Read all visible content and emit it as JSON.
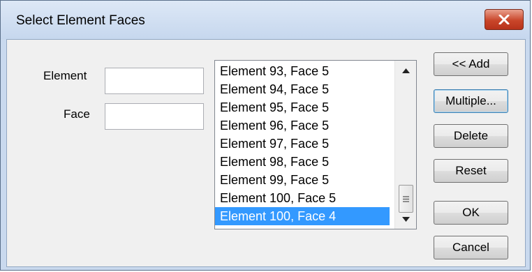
{
  "window": {
    "title": "Select Element Faces"
  },
  "icons": {
    "close": "close-icon",
    "scroll_up": "chevron-up-icon",
    "scroll_down": "chevron-down-icon",
    "thumb_grip": "grip-icon"
  },
  "colors": {
    "selection": "#3399ff",
    "close_button": "#c9462a",
    "title_bar": "#c6d7ee"
  },
  "form": {
    "element_label": "Element",
    "element_value": "",
    "face_label": "Face",
    "face_value": ""
  },
  "list": {
    "items": [
      "Element 93, Face 5",
      "Element 94, Face 5",
      "Element 95, Face 5",
      "Element 96, Face 5",
      "Element 97, Face 5",
      "Element 98, Face 5",
      "Element 99, Face 5",
      "Element 100, Face 5",
      "Element 100, Face 4"
    ],
    "selected_index": 8
  },
  "buttons": {
    "add": "<< Add",
    "multiple": "Multiple...",
    "delete": "Delete",
    "reset": "Reset",
    "ok": "OK",
    "cancel": "Cancel"
  }
}
